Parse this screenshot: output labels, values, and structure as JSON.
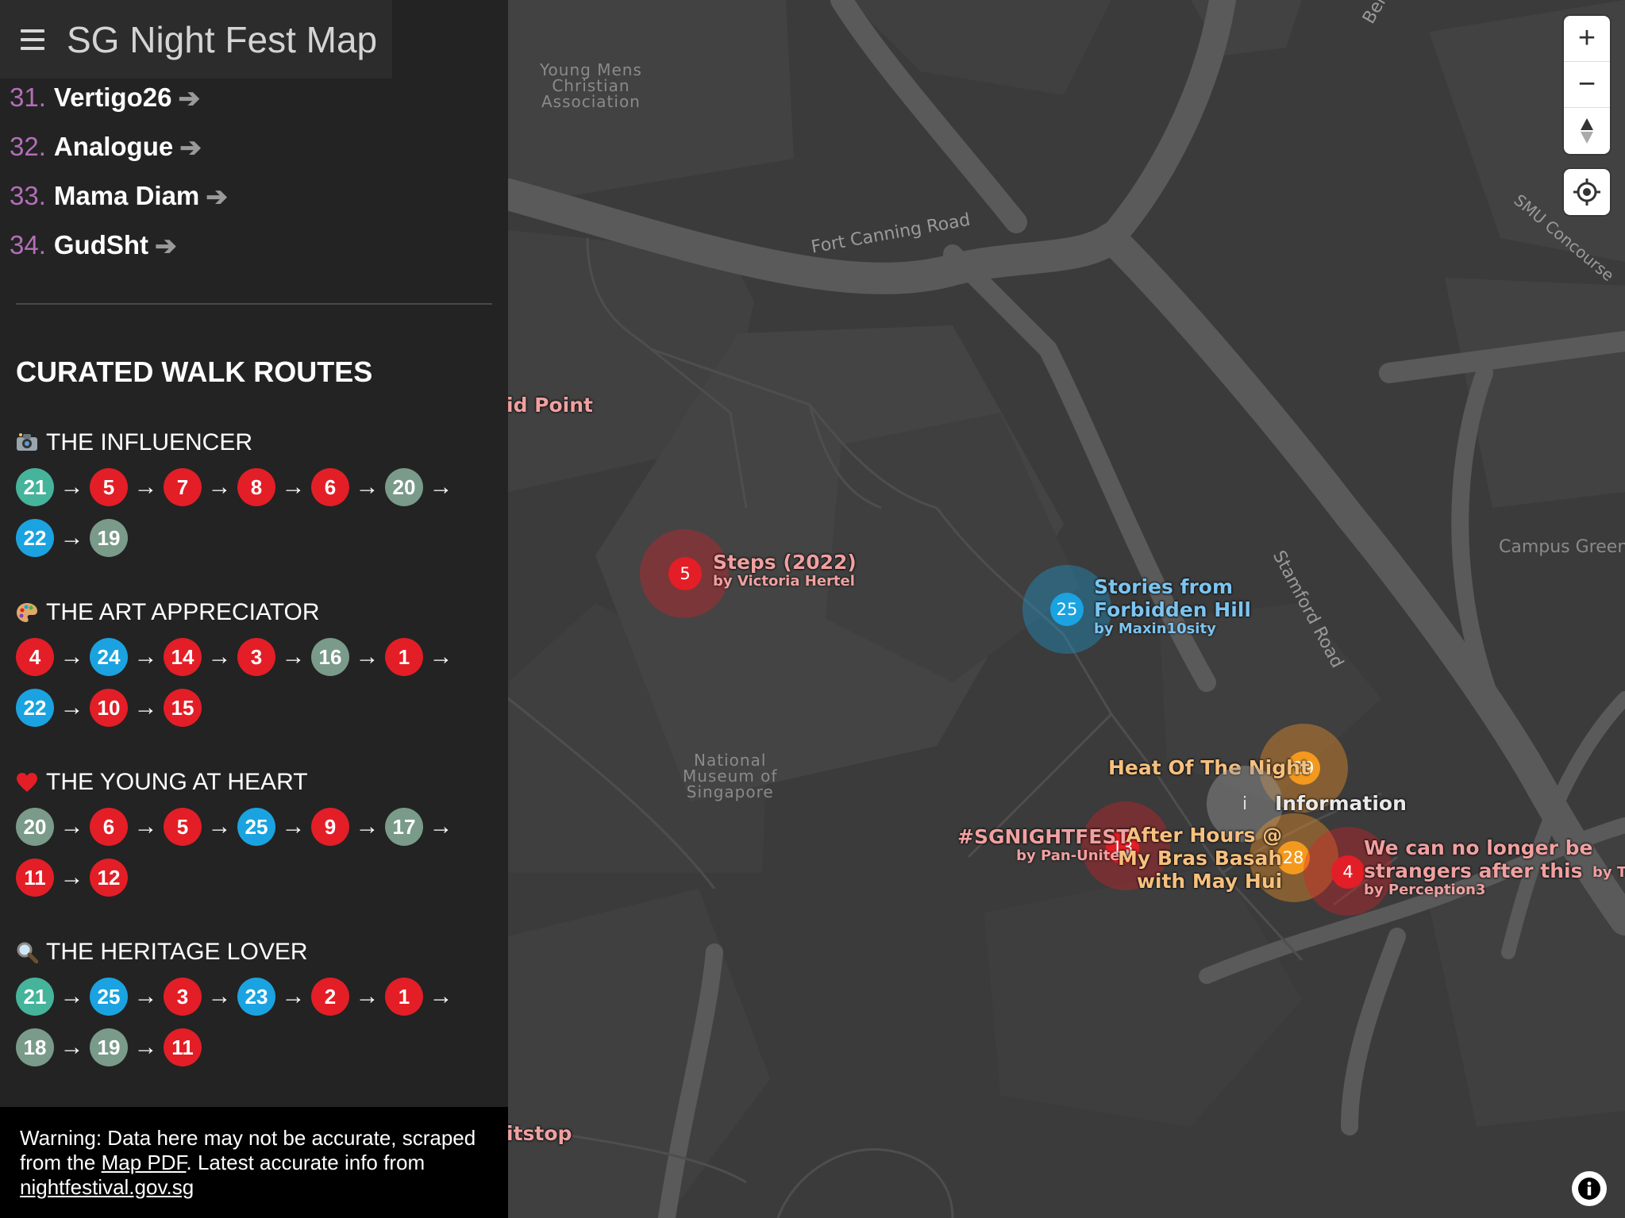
{
  "app": {
    "title": "SG Night Fest Map"
  },
  "venues": [
    {
      "num": "31.",
      "name": "Vertigo26",
      "arrow": "➔"
    },
    {
      "num": "32.",
      "name": "Analogue",
      "arrow": "➔"
    },
    {
      "num": "33.",
      "name": "Mama Diam",
      "arrow": "➔"
    },
    {
      "num": "34.",
      "name": "GudSht",
      "arrow": "➔"
    }
  ],
  "routes_section": {
    "title": "CURATED WALK ROUTES",
    "routes": [
      {
        "icon": "camera-emoji-icon",
        "name": "THE INFLUENCER",
        "stops": [
          {
            "n": "21",
            "c": "teal"
          },
          {
            "n": "5",
            "c": "red"
          },
          {
            "n": "7",
            "c": "red"
          },
          {
            "n": "8",
            "c": "red"
          },
          {
            "n": "6",
            "c": "red"
          },
          {
            "n": "20",
            "c": "gray"
          },
          {
            "n": "22",
            "c": "blue"
          },
          {
            "n": "19",
            "c": "gray"
          }
        ]
      },
      {
        "icon": "palette-emoji-icon",
        "name": "THE ART APPRECIATOR",
        "stops": [
          {
            "n": "4",
            "c": "red"
          },
          {
            "n": "24",
            "c": "blue"
          },
          {
            "n": "14",
            "c": "red"
          },
          {
            "n": "3",
            "c": "red"
          },
          {
            "n": "16",
            "c": "gray"
          },
          {
            "n": "1",
            "c": "red"
          },
          {
            "n": "22",
            "c": "blue"
          },
          {
            "n": "10",
            "c": "red"
          },
          {
            "n": "15",
            "c": "red"
          }
        ]
      },
      {
        "icon": "heart-emoji-icon",
        "name": "THE YOUNG AT HEART",
        "stops": [
          {
            "n": "20",
            "c": "gray"
          },
          {
            "n": "6",
            "c": "red"
          },
          {
            "n": "5",
            "c": "red"
          },
          {
            "n": "25",
            "c": "blue"
          },
          {
            "n": "9",
            "c": "red"
          },
          {
            "n": "17",
            "c": "gray"
          },
          {
            "n": "11",
            "c": "red"
          },
          {
            "n": "12",
            "c": "red"
          }
        ]
      },
      {
        "icon": "magnifier-emoji-icon",
        "name": "THE HERITAGE LOVER",
        "stops": [
          {
            "n": "21",
            "c": "teal"
          },
          {
            "n": "25",
            "c": "blue",
            "hl": true
          },
          {
            "n": "3",
            "c": "red"
          },
          {
            "n": "23",
            "c": "blue"
          },
          {
            "n": "2",
            "c": "red"
          },
          {
            "n": "1",
            "c": "red"
          },
          {
            "n": "18",
            "c": "gray"
          },
          {
            "n": "19",
            "c": "gray",
            "hl": true
          },
          {
            "n": "11",
            "c": "red"
          }
        ]
      }
    ]
  },
  "warning": {
    "part1": "Warning: Data here may not be accurate, scraped from the ",
    "link1": "Map PDF",
    "part2": ". Latest accurate info from ",
    "link2": "nightfestival.gov.sg"
  },
  "map": {
    "area_labels": {
      "ymca": "Young Mens\nChristian\nAssociation",
      "museum": "National\nMuseum of\nSingapore",
      "campus_green": "Campus Green"
    },
    "road_labels": {
      "fort_canning": "Fort Canning Road",
      "stamford": "Stamford Road",
      "smu": "SMU Concourse",
      "ben": "Ben"
    },
    "cut_labels": {
      "aid_point": "id Point",
      "pitstop": "itstop",
      "by_t": "by T"
    },
    "pins": {
      "steps": {
        "num": "5",
        "title": "Steps (2022)",
        "by": "by Victoria Hertel"
      },
      "stories": {
        "num": "25",
        "title1": "Stories from",
        "title2": "Forbidden Hill",
        "by": "by Maxin10sity"
      },
      "heat": {
        "num": "29",
        "title": "Heat Of The Night"
      },
      "info": {
        "icon": "i",
        "title": "Information"
      },
      "sgnightfest": {
        "num": "13",
        "title": "#SGNIGHTFEST",
        "by": "by Pan-United"
      },
      "after_hours": {
        "num": "28",
        "title1": "After Hours @",
        "title2": "My Bras Basah",
        "title3": "with May Hui"
      },
      "strangers": {
        "num": "4",
        "title1": "We can no longer be",
        "title2": "strangers after this",
        "by": "by Perception3"
      }
    },
    "controls": {
      "zoom_in": "+",
      "zoom_out": "−",
      "compass": "▲",
      "attribution": "i"
    }
  }
}
